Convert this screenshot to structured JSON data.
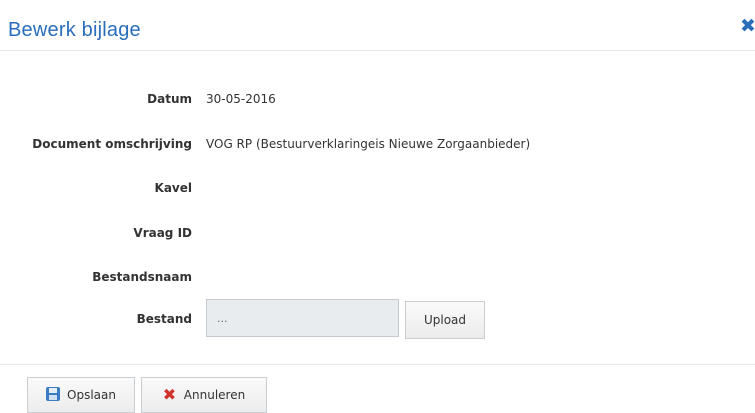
{
  "dialog": {
    "title": "Bewerk bijlage",
    "close_glyph": "✖",
    "accent_color": "#2a6ebb"
  },
  "fields": {
    "datum": {
      "label": "Datum",
      "value": "30-05-2016"
    },
    "omschrijving": {
      "label": "Document omschrijving",
      "value": "VOG RP (Bestuurverklaringeis Nieuwe Zorgaanbieder)"
    },
    "kavel": {
      "label": "Kavel",
      "value": ""
    },
    "vraag_id": {
      "label": "Vraag ID",
      "value": ""
    },
    "bestandsnaam": {
      "label": "Bestandsnaam",
      "value": ""
    },
    "bestand": {
      "label": "Bestand",
      "placeholder": "...",
      "upload_label": "Upload"
    }
  },
  "footer": {
    "save_label": "Opslaan",
    "save_icon": "floppy-disk-icon",
    "cancel_label": "Annuleren",
    "cancel_icon": "red-x-icon",
    "cancel_glyph": "✖",
    "cancel_color": "#d0332c"
  }
}
